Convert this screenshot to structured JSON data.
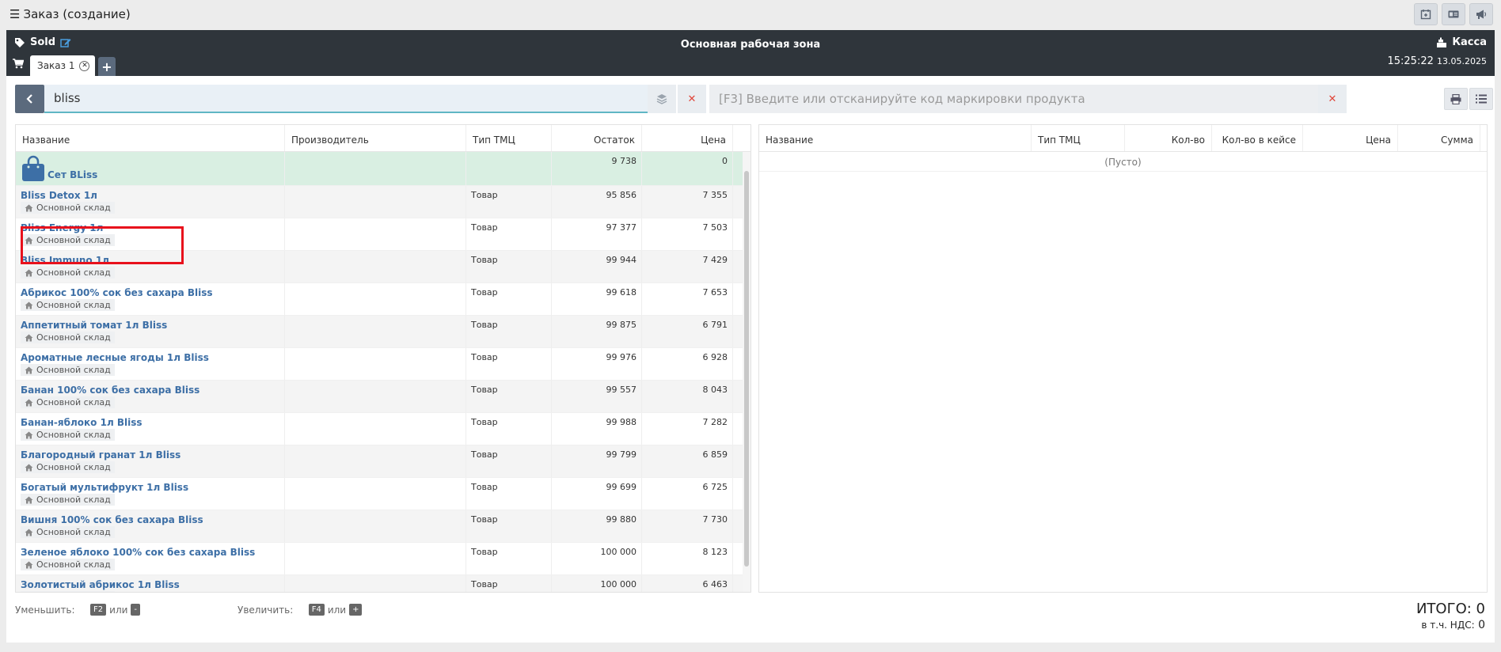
{
  "window": {
    "title": "Заказ (создание)"
  },
  "header": {
    "sold_label": "Sold",
    "zone_title": "Основная рабочая зона",
    "kassa_label": "Касса",
    "time": "15:25:22",
    "date": "13.05.2025",
    "tab_label": "Заказ 1"
  },
  "search": {
    "value": "bliss",
    "code_placeholder": "[F3] Введите или отсканируйте код маркировки продукта"
  },
  "left_table": {
    "columns": [
      "Название",
      "Производитель",
      "Тип ТМЦ",
      "Остаток",
      "Цена"
    ],
    "set_row": {
      "name": "Сет BLiss",
      "stock": "9 738",
      "price": "0"
    },
    "rows": [
      {
        "name": "Bliss Detox 1л",
        "warehouse": "Основной склад",
        "type": "Товар",
        "stock": "95 856",
        "price": "7 355"
      },
      {
        "name": "Bliss Energy 1л",
        "warehouse": "Основной склад",
        "type": "Товар",
        "stock": "97 377",
        "price": "7 503"
      },
      {
        "name": "Bliss Immuno 1л",
        "warehouse": "Основной склад",
        "type": "Товар",
        "stock": "99 944",
        "price": "7 429"
      },
      {
        "name": "Абрикос 100% сок без сахара Bliss",
        "warehouse": "Основной склад",
        "type": "Товар",
        "stock": "99 618",
        "price": "7 653"
      },
      {
        "name": "Аппетитный томат 1л Bliss",
        "warehouse": "Основной склад",
        "type": "Товар",
        "stock": "99 875",
        "price": "6 791"
      },
      {
        "name": "Ароматные лесные ягоды 1л Bliss",
        "warehouse": "Основной склад",
        "type": "Товар",
        "stock": "99 976",
        "price": "6 928"
      },
      {
        "name": "Банан 100% сок без сахара Bliss",
        "warehouse": "Основной склад",
        "type": "Товар",
        "stock": "99 557",
        "price": "8 043"
      },
      {
        "name": "Банан-яблоко 1л Bliss",
        "warehouse": "Основной склад",
        "type": "Товар",
        "stock": "99 988",
        "price": "7 282"
      },
      {
        "name": "Благородный гранат 1л Bliss",
        "warehouse": "Основной склад",
        "type": "Товар",
        "stock": "99 799",
        "price": "6 859"
      },
      {
        "name": "Богатый мультифрукт 1л Bliss",
        "warehouse": "Основной склад",
        "type": "Товар",
        "stock": "99 699",
        "price": "6 725"
      },
      {
        "name": "Вишня 100% сок без сахара Bliss",
        "warehouse": "Основной склад",
        "type": "Товар",
        "stock": "99 880",
        "price": "7 730"
      },
      {
        "name": "Зеленое яблоко 100% сок без сахара Bliss",
        "warehouse": "Основной склад",
        "type": "Товар",
        "stock": "100 000",
        "price": "8 123"
      },
      {
        "name": "Золотистый абрикос 1л Bliss",
        "warehouse": "Основной склад",
        "type": "Товар",
        "stock": "100 000",
        "price": "6 463"
      }
    ]
  },
  "right_table": {
    "columns": [
      "Название",
      "Тип ТМЦ",
      "Кол-во",
      "Кол-во в кейсе",
      "Цена",
      "Сумма"
    ],
    "empty_text": "(Пусто)"
  },
  "footer": {
    "decrease_label": "Уменьшить:",
    "increase_label": "Увеличить:",
    "or": "или",
    "key_f2": "F2",
    "key_minus": "-",
    "key_f4": "F4",
    "key_plus": "+",
    "total_label": "ИТОГО:",
    "total_value": "0",
    "vat_label": "в т.ч. НДС:",
    "vat_value": "0"
  },
  "colors": {
    "header_bg": "#2f353b",
    "accent": "#5b6a7d",
    "link": "#3d6fa6",
    "selected_row": "#d9efe2",
    "highlight": "#e8111c"
  }
}
